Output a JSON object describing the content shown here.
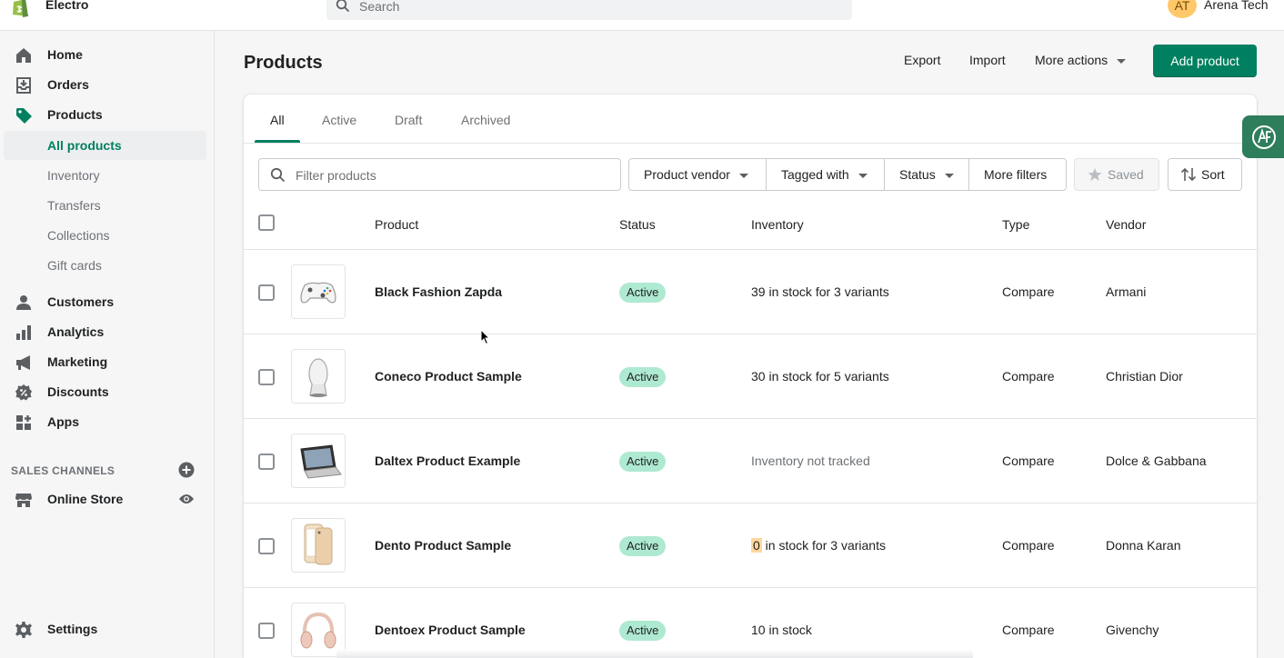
{
  "topbar": {
    "store_name": "Electro",
    "search_placeholder": "Search",
    "avatar_initials": "AT",
    "user_name": "Arena Tech"
  },
  "sidebar": {
    "items": [
      {
        "label": "Home",
        "icon": "home-icon"
      },
      {
        "label": "Orders",
        "icon": "orders-icon"
      },
      {
        "label": "Products",
        "icon": "tag-icon"
      }
    ],
    "product_subitems": [
      {
        "label": "All products",
        "selected": true
      },
      {
        "label": "Inventory"
      },
      {
        "label": "Transfers"
      },
      {
        "label": "Collections"
      },
      {
        "label": "Gift cards"
      }
    ],
    "items2": [
      {
        "label": "Customers",
        "icon": "person-icon"
      },
      {
        "label": "Analytics",
        "icon": "bar-chart-icon"
      },
      {
        "label": "Marketing",
        "icon": "megaphone-icon"
      },
      {
        "label": "Discounts",
        "icon": "discount-icon"
      },
      {
        "label": "Apps",
        "icon": "apps-icon"
      }
    ],
    "sales_channels_title": "SALES CHANNELS",
    "online_store": "Online Store",
    "settings": "Settings"
  },
  "header": {
    "title": "Products",
    "export": "Export",
    "import": "Import",
    "more_actions": "More actions",
    "add_product": "Add product"
  },
  "tabs": [
    "All",
    "Active",
    "Draft",
    "Archived"
  ],
  "filters": {
    "placeholder": "Filter products",
    "product_vendor": "Product vendor",
    "tagged_with": "Tagged with",
    "status": "Status",
    "more_filters": "More filters",
    "saved": "Saved",
    "sort": "Sort"
  },
  "table": {
    "headers": {
      "product": "Product",
      "status": "Status",
      "inventory": "Inventory",
      "type": "Type",
      "vendor": "Vendor"
    },
    "rows": [
      {
        "name": "Black Fashion Zapda",
        "status": "Active",
        "inventory": "39 in stock for 3 variants",
        "type": "Compare",
        "vendor": "Armani",
        "thumb": "controller"
      },
      {
        "name": "Coneco Product Sample",
        "status": "Active",
        "inventory": "30 in stock for 5 variants",
        "type": "Compare",
        "vendor": "Christian Dior",
        "thumb": "speaker"
      },
      {
        "name": "Daltex Product Example",
        "status": "Active",
        "inventory": "Inventory not tracked",
        "type": "Compare",
        "vendor": "Dolce & Gabbana",
        "thumb": "laptop"
      },
      {
        "name": "Dento Product Sample",
        "status": "Active",
        "inventory_count": "0",
        "inventory_rest": " in stock for 3 variants",
        "type": "Compare",
        "vendor": "Donna Karan",
        "thumb": "phone"
      },
      {
        "name": "Dentoex Product Sample",
        "status": "Active",
        "inventory": "10 in stock",
        "type": "Compare",
        "vendor": "Givenchy",
        "thumb": "headphones"
      }
    ]
  },
  "colors": {
    "accent": "#008060",
    "badge_active": "#aee9d1",
    "warning": "#ffd79d"
  }
}
